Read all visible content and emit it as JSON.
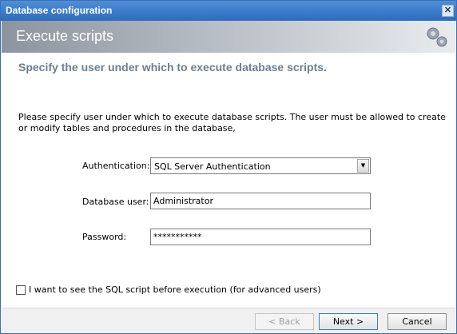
{
  "window": {
    "title": "Database configuration"
  },
  "header": {
    "title": "Execute scripts"
  },
  "content": {
    "subtitle": "Specify the user under which to execute database scripts.",
    "description": "Please specify user under which to execute database scripts. The user must be allowed to create or modify tables and procedures in the database,"
  },
  "form": {
    "authentication_label": "Authentication:",
    "authentication_value": "SQL Server Authentication",
    "database_user_label": "Database user:",
    "database_user_value": "Administrator",
    "password_label": "Password:",
    "password_value": "***********"
  },
  "options": {
    "show_script_label": "I want to see the SQL script before execution (for advanced users)"
  },
  "buttons": {
    "back": "< Back",
    "next": "Next >",
    "cancel": "Cancel"
  },
  "icons": {
    "close": "close-icon",
    "gears": "gears-icon",
    "dropdown": "chevron-down-icon"
  },
  "colors": {
    "titlebar": "#2d6bbf",
    "subtitle": "#6b7f93"
  }
}
